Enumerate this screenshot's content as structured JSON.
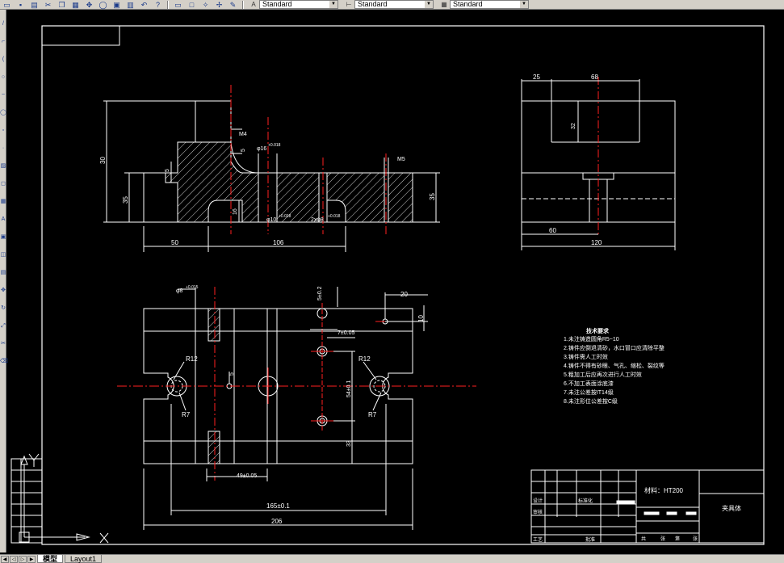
{
  "toolbar": {
    "icons": [
      "open-icon",
      "save-icon",
      "print-icon",
      "cut-icon",
      "copy-icon",
      "paste-icon",
      "undo-icon",
      "pan-icon",
      "zoom-icon",
      "properties-icon",
      "layer-icon",
      "help-icon"
    ],
    "combos": [
      {
        "name": "text-style-combo",
        "value": "Standard"
      },
      {
        "name": "dim-style-combo",
        "value": "Standard"
      },
      {
        "name": "table-style-combo",
        "value": "Standard"
      }
    ]
  },
  "tabs": {
    "model": "模型",
    "layout1": "Layout1"
  },
  "drawing": {
    "front_dims": {
      "d30": "30",
      "d35_left": "35",
      "d5": "5",
      "m4": "M4",
      "d5b": "5",
      "phi16": "φ16",
      "tol_phi16": "+0.018",
      "m5": "M5",
      "d35_right": "35",
      "d16": "16",
      "phi10": "φ10",
      "tol_phi10": "+0.018",
      "two_phi8": "2xφ8",
      "tol_phi8": "+0.018",
      "d50": "50",
      "d106": "106"
    },
    "side_dims": {
      "d25": "25",
      "d68": "68",
      "d32": "32",
      "d60": "60",
      "d120": "120"
    },
    "top_dims": {
      "phi8": "φ8",
      "tol_phi8": "+0.015",
      "d5_02": "5±0.2",
      "d20": "20",
      "d10": "10",
      "d7_05": "7±0.05",
      "r12_left": "R12",
      "r12_right": "R12",
      "r7_left": "R7",
      "r7_right": "R7",
      "d5": "5",
      "d54": "54±0.1",
      "d33": "33",
      "d49": "49±0.05",
      "d165": "165±0.1",
      "d206": "206"
    },
    "notes": {
      "title": "技术要求",
      "lines": [
        "1.未注铸造圆角R5~10",
        "2.铸件应倒退清砂，水口冒口应清除平整",
        "3.铸件需人工时效",
        "4.铸件不得有砂眼、气孔、缩松、裂纹等",
        "5.粗加工后应再次进行人工时效",
        "6.不加工表面涂底漆",
        "7.未注公差按IT14级",
        "8.未注形位公差按C级"
      ]
    },
    "title_block": {
      "material": "材料：HT200",
      "part_name": "夹具体",
      "labels": [
        "设计",
        "标准化",
        "审核",
        "工艺",
        "批准"
      ],
      "bottom_labels": [
        "共",
        "张",
        "第",
        "张"
      ]
    }
  },
  "colors": {
    "background": "#000000",
    "line": "#ffffff",
    "center": "#ff2020",
    "hatch": "#ffffff"
  }
}
